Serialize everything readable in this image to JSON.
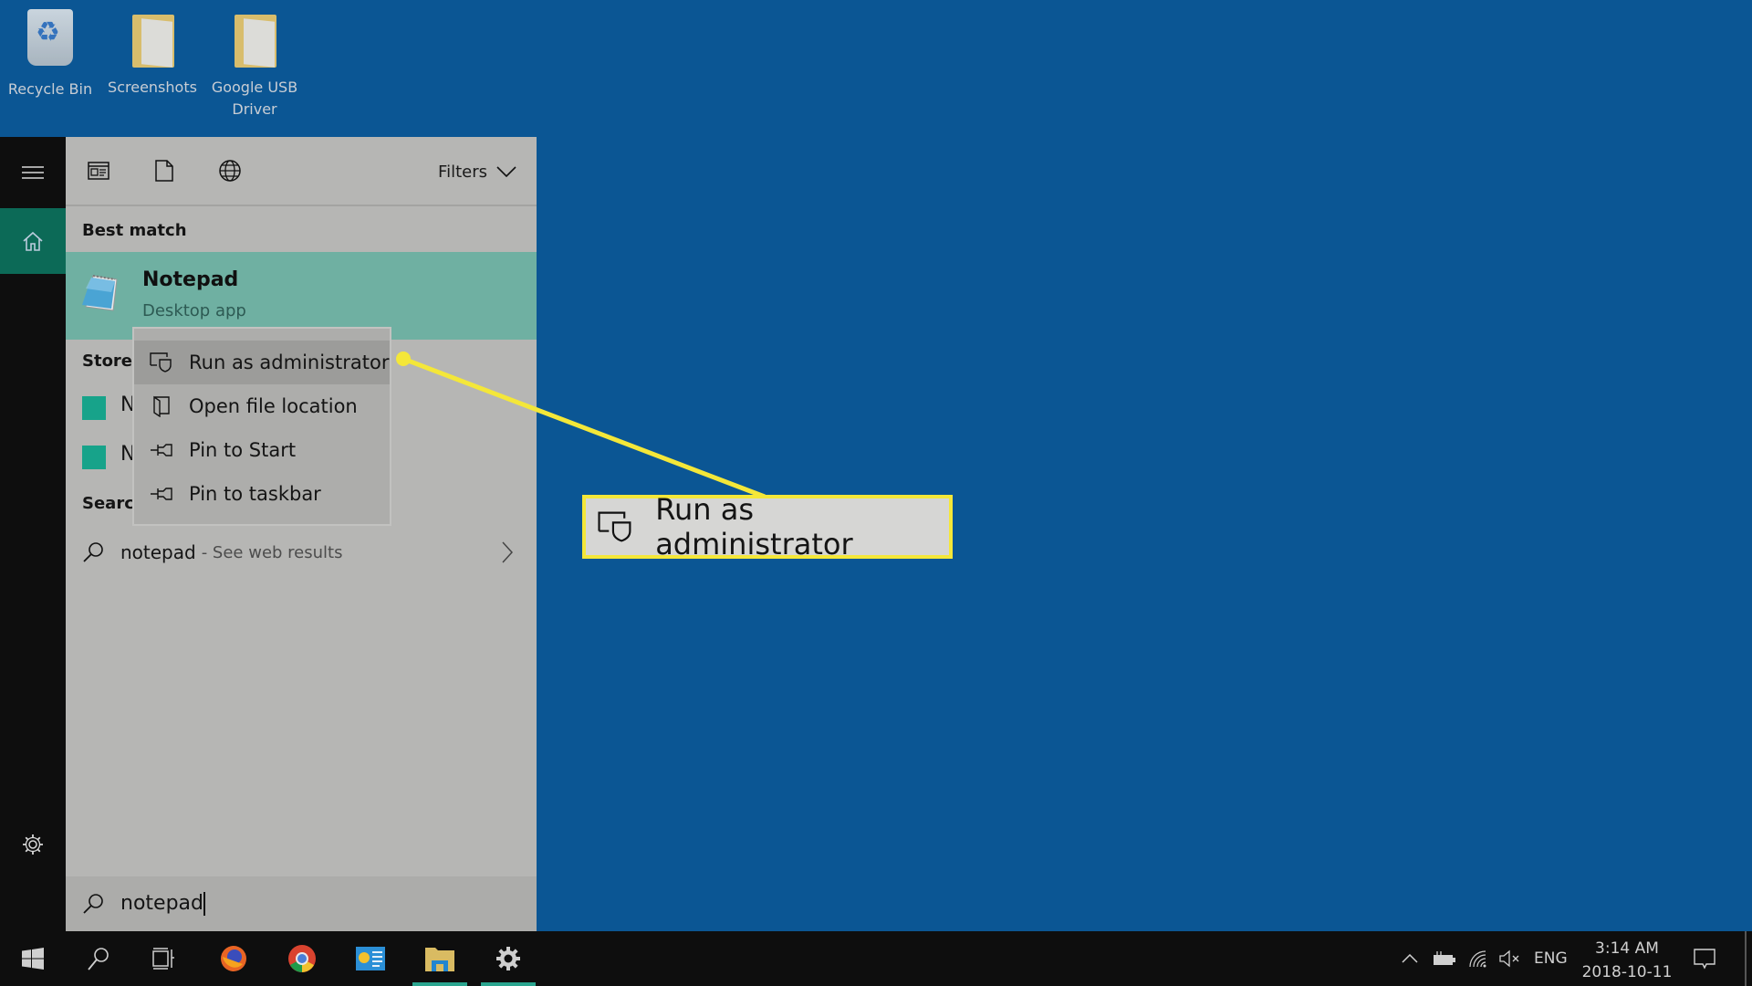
{
  "desktop": {
    "background_color": "#0b5694",
    "icons": [
      {
        "label": "Recycle Bin",
        "icon": "recycle-bin-icon"
      },
      {
        "label": "Screenshots",
        "icon": "folder-icon"
      },
      {
        "label": "Google USB Driver",
        "icon": "folder-icon"
      }
    ]
  },
  "start_rail": {
    "items": [
      {
        "name": "menu",
        "icon": "hamburger-menu-icon"
      },
      {
        "name": "home",
        "icon": "home-icon",
        "active": true
      },
      {
        "name": "settings",
        "icon": "gear-icon"
      }
    ],
    "accent_color": "#0c6a57"
  },
  "search_panel": {
    "toolbar": {
      "scopes": [
        {
          "name": "apps",
          "icon": "apps-window-icon"
        },
        {
          "name": "documents",
          "icon": "document-icon"
        },
        {
          "name": "web",
          "icon": "globe-icon"
        }
      ],
      "filters_label": "Filters"
    },
    "best_match": {
      "section_label": "Best match",
      "title": "Notepad",
      "subtitle": "Desktop app",
      "icon": "notepad-icon",
      "highlight_color": "#6fb0a2"
    },
    "store": {
      "section_label": "Store",
      "items": [
        {
          "label": "N",
          "icon": "store-app-icon"
        },
        {
          "label": "N",
          "icon": "store-app-icon"
        }
      ]
    },
    "web": {
      "section_label": "Search",
      "query": "notepad",
      "hint": "- See web results"
    },
    "search_box": {
      "value": "notepad",
      "icon": "search-icon"
    }
  },
  "context_menu": {
    "items": [
      {
        "label": "Run as administrator",
        "icon": "shield-admin-icon",
        "highlighted": true
      },
      {
        "label": "Open file location",
        "icon": "folder-location-icon"
      },
      {
        "label": "Pin to Start",
        "icon": "pin-icon"
      },
      {
        "label": "Pin to taskbar",
        "icon": "pin-icon"
      }
    ]
  },
  "callout": {
    "label": "Run as administrator",
    "icon": "shield-admin-icon",
    "border_color": "#f4e739"
  },
  "taskbar": {
    "apps": [
      {
        "name": "start",
        "icon": "windows-logo-icon"
      },
      {
        "name": "search",
        "icon": "search-icon"
      },
      {
        "name": "task-view",
        "icon": "task-view-icon"
      },
      {
        "name": "firefox",
        "icon": "firefox-icon"
      },
      {
        "name": "chrome",
        "icon": "chrome-icon"
      },
      {
        "name": "control-panel",
        "icon": "control-panel-icon"
      },
      {
        "name": "file-explorer",
        "icon": "file-explorer-icon",
        "running": true
      },
      {
        "name": "settings",
        "icon": "gear-icon",
        "running": true
      }
    ],
    "tray": {
      "language": "ENG",
      "time": "3:14 AM",
      "date": "2018-10-11"
    }
  }
}
